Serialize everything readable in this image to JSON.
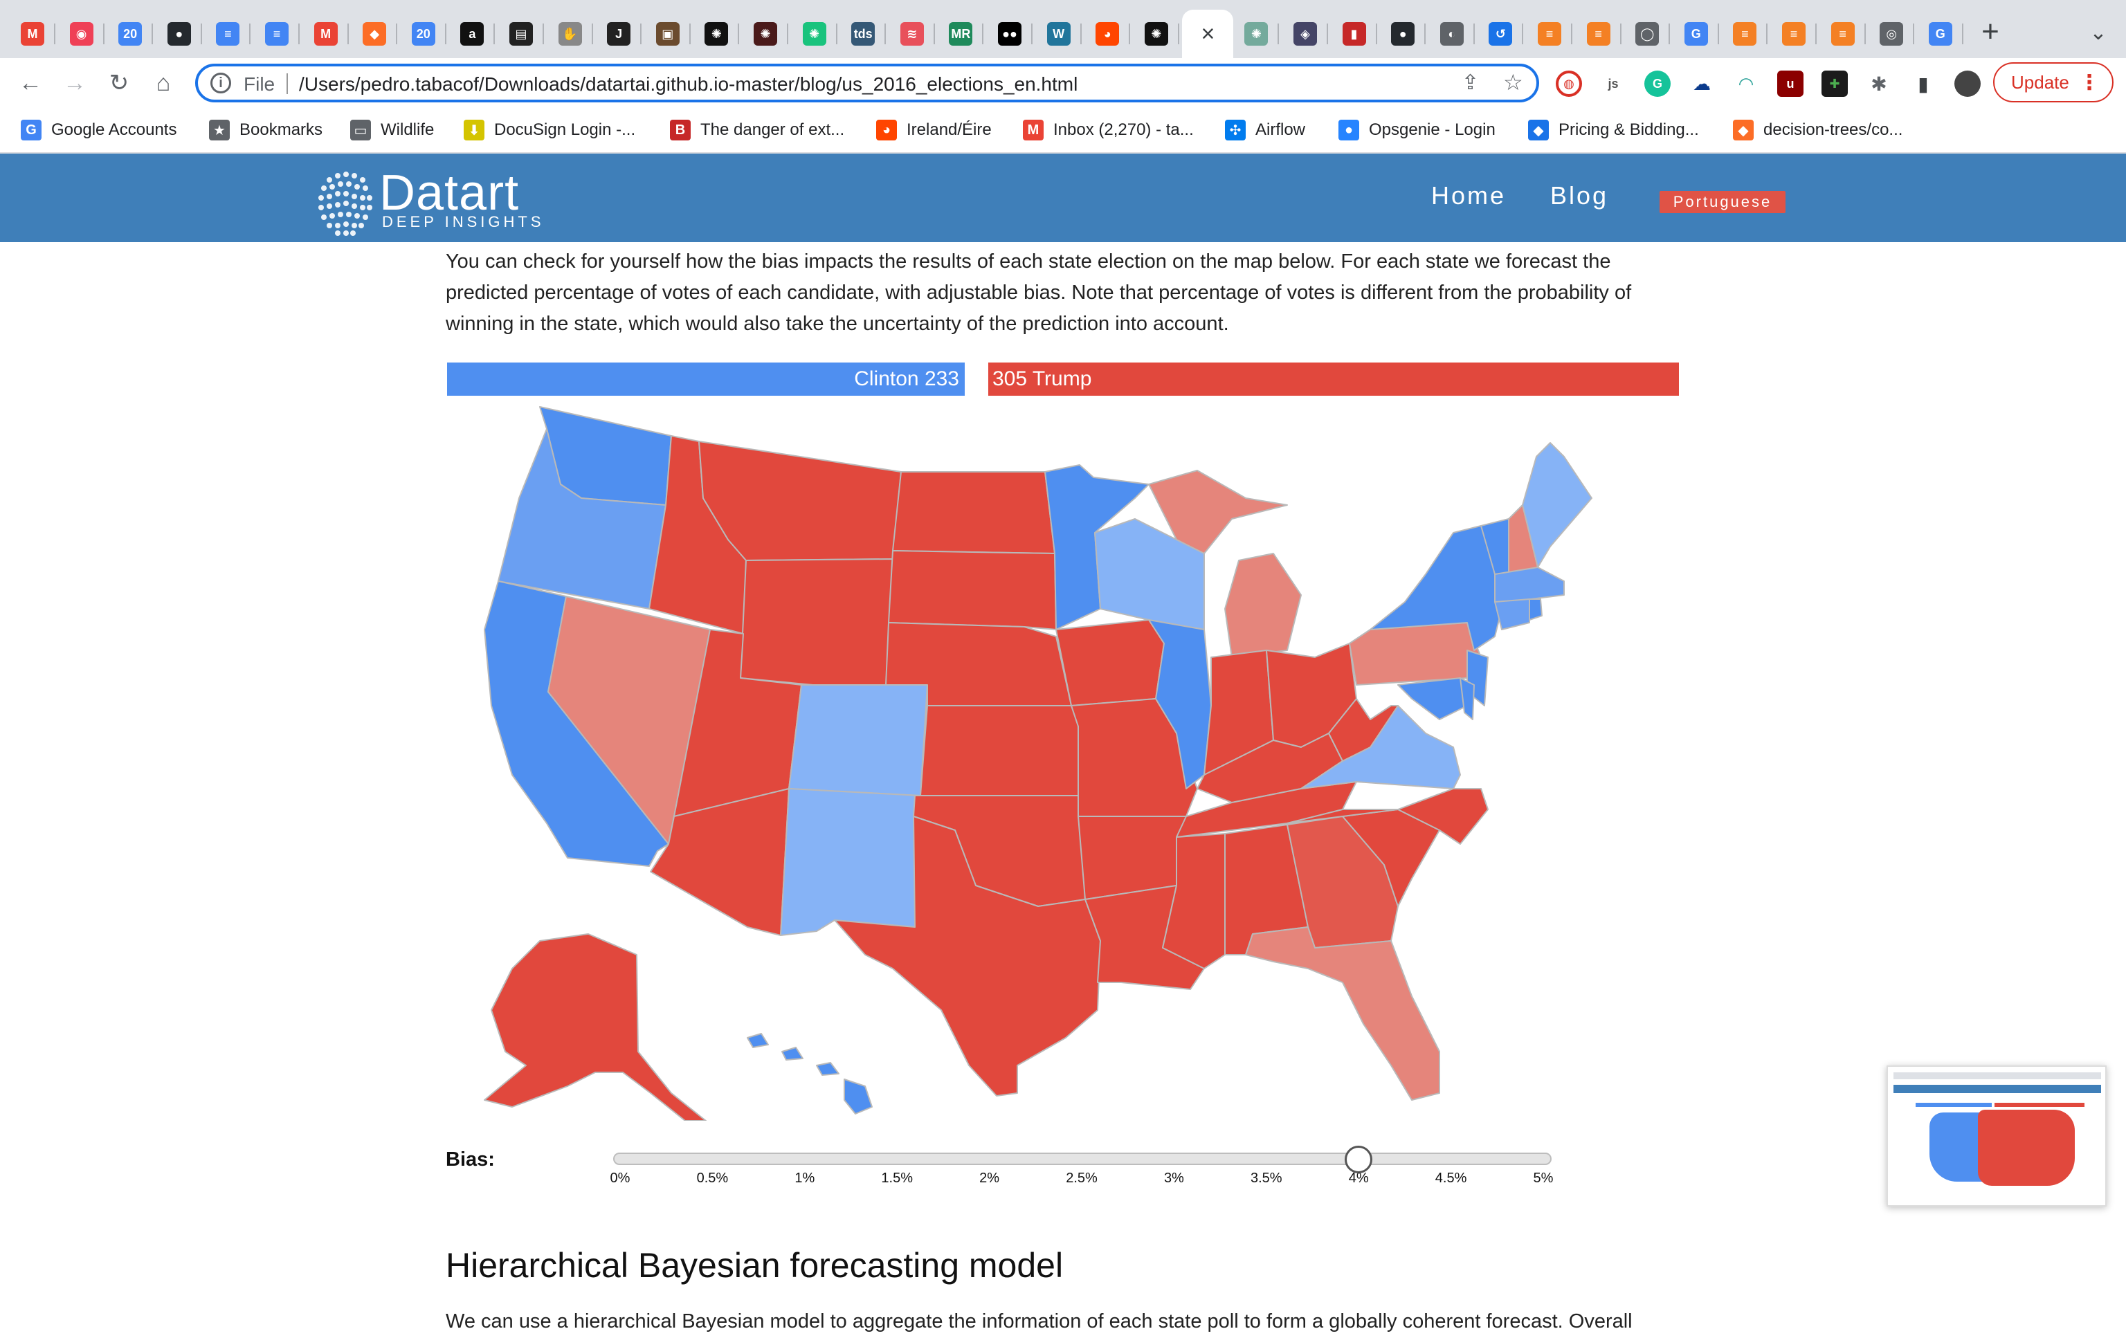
{
  "browser": {
    "tabs": [
      {
        "icon": "gmail-icon",
        "glyph": "M",
        "color": "#ea4335"
      },
      {
        "icon": "pocket-icon",
        "glyph": "◉",
        "color": "#ef4056"
      },
      {
        "icon": "calendar-icon",
        "glyph": "20",
        "color": "#4285f4"
      },
      {
        "icon": "github-icon",
        "glyph": "●",
        "color": "#24292e"
      },
      {
        "icon": "docs-icon",
        "glyph": "≡",
        "color": "#4285f4"
      },
      {
        "icon": "docs-icon",
        "glyph": "≡",
        "color": "#4285f4"
      },
      {
        "icon": "gmail-icon",
        "glyph": "M",
        "color": "#ea4335"
      },
      {
        "icon": "gitlab-icon",
        "glyph": "◆",
        "color": "#fc6d26"
      },
      {
        "icon": "calendar-icon",
        "glyph": "20",
        "color": "#4285f4"
      },
      {
        "icon": "amazon-icon",
        "glyph": "a",
        "color": "#111111"
      },
      {
        "icon": "terminal-icon",
        "glyph": "▤",
        "color": "#222222"
      },
      {
        "icon": "hand-icon",
        "glyph": "✋",
        "color": "#888888"
      },
      {
        "icon": "jmlr-icon",
        "glyph": "J",
        "color": "#222222"
      },
      {
        "icon": "photo-icon",
        "glyph": "▣",
        "color": "#6b4b2e"
      },
      {
        "icon": "openai-icon",
        "glyph": "✺",
        "color": "#111111"
      },
      {
        "icon": "openai-icon",
        "glyph": "✺",
        "color": "#4a1a1a"
      },
      {
        "icon": "openai-icon",
        "glyph": "✺",
        "color": "#19c37d"
      },
      {
        "icon": "tds-icon",
        "glyph": "tds",
        "color": "#355876"
      },
      {
        "icon": "stack-icon",
        "glyph": "≋",
        "color": "#e8505b"
      },
      {
        "icon": "mr-icon",
        "glyph": "MR",
        "color": "#1f8a5b"
      },
      {
        "icon": "medium-icon",
        "glyph": "●●",
        "color": "#000000"
      },
      {
        "icon": "wordpress-icon",
        "glyph": "W",
        "color": "#21759b"
      },
      {
        "icon": "reddit-icon",
        "glyph": "◕",
        "color": "#ff4500"
      },
      {
        "icon": "openai-icon",
        "glyph": "✺",
        "color": "#111111"
      },
      {
        "icon": "close-icon",
        "glyph": "×",
        "color": "#3c4043",
        "active": true
      },
      {
        "icon": "openai-icon",
        "glyph": "✺",
        "color": "#74aa9c"
      },
      {
        "icon": "people-icon",
        "glyph": "◈",
        "color": "#444466"
      },
      {
        "icon": "pdf-icon",
        "glyph": "▮",
        "color": "#c62828"
      },
      {
        "icon": "github-icon",
        "glyph": "●",
        "color": "#24292e"
      },
      {
        "icon": "globe-icon",
        "glyph": "◐",
        "color": "#5f6368"
      },
      {
        "icon": "history-icon",
        "glyph": "↺",
        "color": "#1a73e8"
      },
      {
        "icon": "stackoverflow-icon",
        "glyph": "≡",
        "color": "#f48024"
      },
      {
        "icon": "stackoverflow-icon",
        "glyph": "≡",
        "color": "#f48024"
      },
      {
        "icon": "circle-icon",
        "glyph": "◯",
        "color": "#5f6368"
      },
      {
        "icon": "google-icon",
        "glyph": "G",
        "color": "#4285f4"
      },
      {
        "icon": "stackoverflow-icon",
        "glyph": "≡",
        "color": "#f48024"
      },
      {
        "icon": "stackoverflow-icon",
        "glyph": "≡",
        "color": "#f48024"
      },
      {
        "icon": "stackoverflow-icon",
        "glyph": "≡",
        "color": "#f48024"
      },
      {
        "icon": "chrome-icon",
        "glyph": "◎",
        "color": "#5f6368"
      },
      {
        "icon": "google-icon",
        "glyph": "G",
        "color": "#4285f4"
      }
    ],
    "address": {
      "scheme_label": "File",
      "url": "/Users/pedro.tabacof/Downloads/datartai.github.io-master/blog/us_2016_elections_en.html"
    },
    "update_label": "Update",
    "bookmarks": [
      {
        "label": "Google Accounts",
        "icon": "google-icon",
        "glyph": "G",
        "color": "#4285f4"
      },
      {
        "label": "Bookmarks",
        "icon": "star-icon",
        "glyph": "★",
        "color": "#5f6368"
      },
      {
        "label": "Wildlife",
        "icon": "folder-icon",
        "glyph": "▭",
        "color": "#5f6368"
      },
      {
        "label": "DocuSign Login -...",
        "icon": "docusign-icon",
        "glyph": "⬇",
        "color": "#d4c400"
      },
      {
        "label": "The danger of ext...",
        "icon": "bookmark-red-icon",
        "glyph": "B",
        "color": "#c62828"
      },
      {
        "label": "Ireland/Éire",
        "icon": "reddit-icon",
        "glyph": "◕",
        "color": "#ff4500"
      },
      {
        "label": "Inbox (2,270) - ta...",
        "icon": "gmail-icon",
        "glyph": "M",
        "color": "#ea4335"
      },
      {
        "label": "Airflow",
        "icon": "airflow-icon",
        "glyph": "✣",
        "color": "#017cee"
      },
      {
        "label": "Opsgenie - Login",
        "icon": "opsgenie-icon",
        "glyph": "●",
        "color": "#2684ff"
      },
      {
        "label": "Pricing & Bidding...",
        "icon": "diamond-icon",
        "glyph": "◆",
        "color": "#1a73e8"
      },
      {
        "label": "decision-trees/co...",
        "icon": "gitlab-icon",
        "glyph": "◆",
        "color": "#fc6d26"
      }
    ]
  },
  "site": {
    "logo_text": "Datart",
    "logo_sub": "DEEP INSIGHTS",
    "nav": {
      "home": "Home",
      "blog": "Blog",
      "lang": "Portuguese"
    }
  },
  "article": {
    "intro": "You can check for yourself how the bias impacts the results of each state election on the map below. For each state we forecast the predicted percentage of votes of each candidate, with adjustable bias. Note that percentage of votes is different from the probability of winning in the state, which would also take the uncertainty of the prediction into account.",
    "clinton_label": "Clinton 233",
    "trump_label": "305 Trump",
    "bias_label": "Bias:",
    "bias_ticks": [
      "0%",
      "0.5%",
      "1%",
      "1.5%",
      "2%",
      "2.5%",
      "3%",
      "3.5%",
      "4%",
      "4.5%",
      "5%"
    ],
    "bias_value_percent": 4,
    "section_heading": "Hierarchical Bayesian forecasting model",
    "section_text": "We can use a hierarchical Bayesian model to aggregate the information of each state poll to form a globally coherent forecast. Overall"
  },
  "electoral_votes": {
    "clinton": 233,
    "trump": 305
  },
  "colors": {
    "dem_solid": "#4f8ff0",
    "dem_light": "#6a9ff2",
    "dem_lean": "#86b3f6",
    "rep_solid": "#e1483d",
    "rep_lean": "#e5857b",
    "rep_mid": "#e2584d",
    "header_bg": "#3f7fb9",
    "lang_button": "#e05346"
  }
}
